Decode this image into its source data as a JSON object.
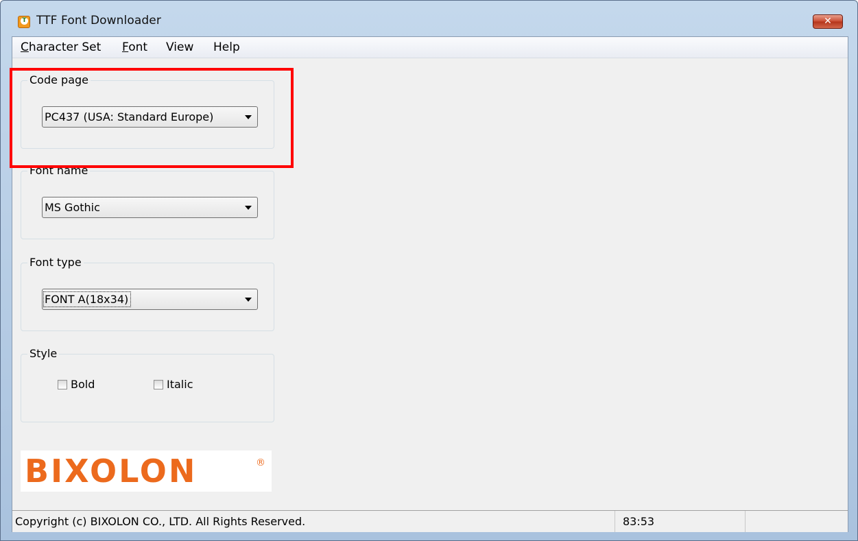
{
  "window": {
    "title": "TTF Font Downloader",
    "close_label": "✕"
  },
  "menubar": {
    "items": [
      {
        "label": "Character Set"
      },
      {
        "label": "Font"
      },
      {
        "label": "View"
      },
      {
        "label": "Help"
      }
    ]
  },
  "code_page": {
    "title": "Code page",
    "selected": "PC437 (USA: Standard Europe)"
  },
  "font_name": {
    "title": "Font name",
    "selected": "MS Gothic"
  },
  "font_type": {
    "title": "Font type",
    "selected": "FONT A(18x34)"
  },
  "style": {
    "title": "Style",
    "bold_label": "Bold",
    "italic_label": "Italic",
    "bold_checked": false,
    "italic_checked": false
  },
  "logo": {
    "text": "BIXOLON",
    "mark": "®"
  },
  "statusbar": {
    "copyright": "Copyright (c) BIXOLON CO., LTD. All Rights Reserved.",
    "position": "83:53",
    "extra": ""
  },
  "colors": {
    "logo_orange": "#ec6a1d",
    "highlight_red": "#ff0000",
    "close_red": "#c94a30"
  }
}
